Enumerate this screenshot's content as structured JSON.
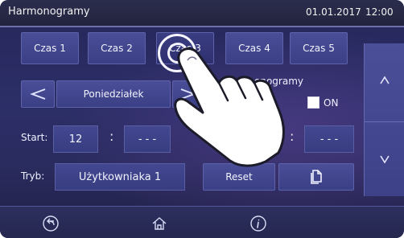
{
  "header": {
    "title": "Harmonogramy",
    "date": "01.01.2017",
    "time": "12:00"
  },
  "tabs": [
    {
      "label": "Czas 1"
    },
    {
      "label": "Czas 2"
    },
    {
      "label": "Czas 3"
    },
    {
      "label": "Czas 4"
    },
    {
      "label": "Czas 5"
    }
  ],
  "day_selector": {
    "day": "Poniedziałek",
    "prev_icon": "arrow-left-icon",
    "next_icon": "arrow-right-icon"
  },
  "schedules_toggle": {
    "label": "Harmonogramy",
    "visible_label": "onogramy",
    "state_label": "ON"
  },
  "start": {
    "label": "Start:",
    "hour": "12",
    "separator": ":",
    "minute": "- - -"
  },
  "end": {
    "separator": ":",
    "minute": "- - -"
  },
  "mode": {
    "label": "Tryb:",
    "value": "Użytkowniaka 1"
  },
  "buttons": {
    "reset": "Reset",
    "copy_icon": "copy-icon"
  },
  "scroll": {
    "up_icon": "chevron-up-icon",
    "down_icon": "chevron-down-icon"
  },
  "bottom": {
    "back_icon": "back-icon",
    "home_icon": "home-icon",
    "info_icon": "info-icon"
  },
  "colors": {
    "background": "#2c2e67",
    "button": "#4a4e97",
    "titlebar": "#2b2d4d"
  }
}
